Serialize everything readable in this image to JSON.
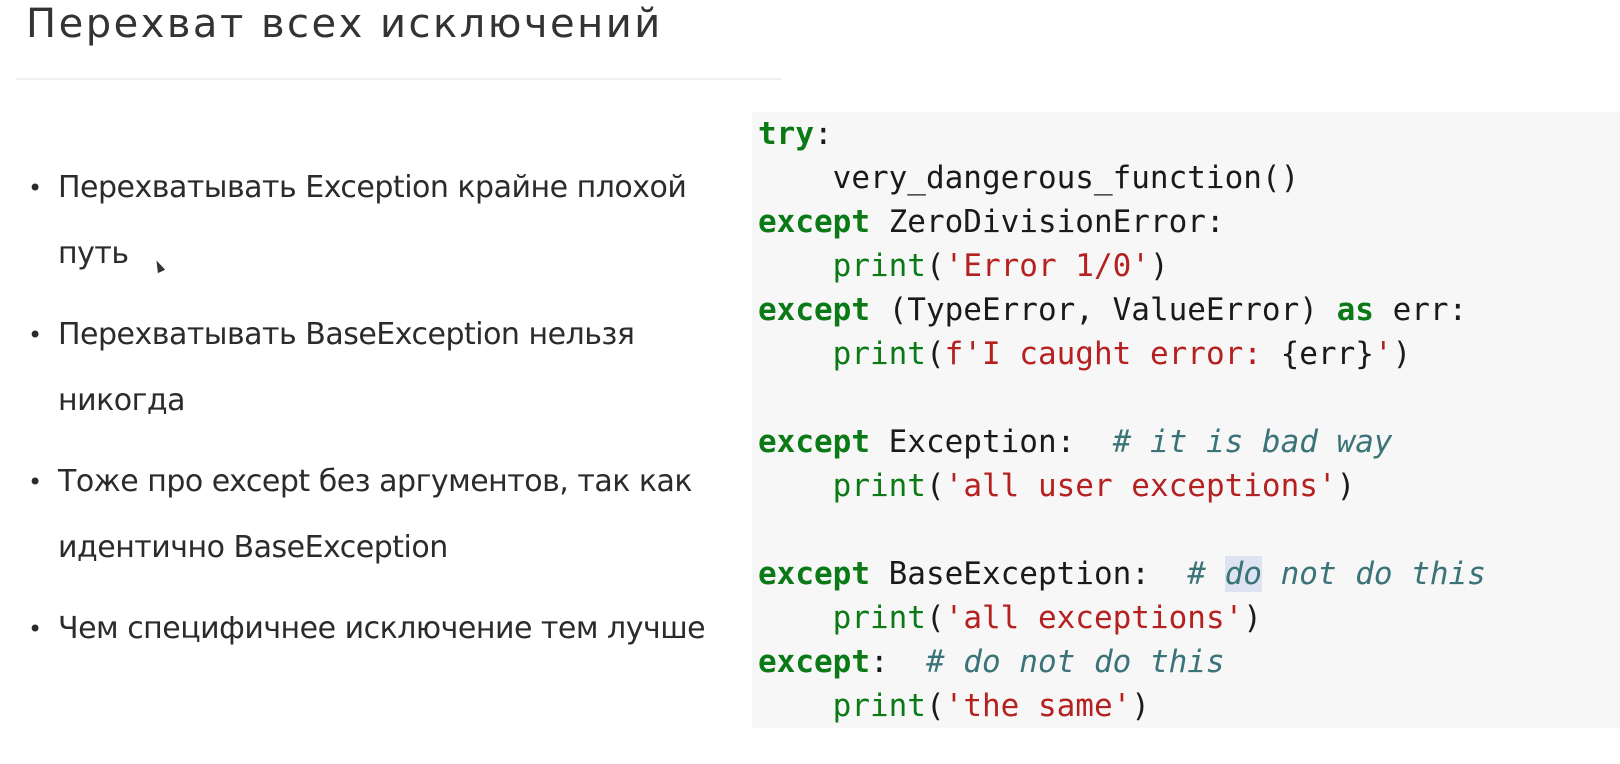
{
  "slide": {
    "title": "Перехват всех исключений",
    "bullets": [
      "Перехватывать Exception крайне плохой путь",
      "Перехватывать BaseException нельзя никогда",
      "Тоже про except без аргументов, так как идентично BaseException",
      "Чем специфичнее исключение тем лучше"
    ]
  },
  "code": {
    "lines": [
      [
        {
          "t": "try",
          "c": "kw"
        },
        {
          "t": ":",
          "c": ""
        }
      ],
      [
        {
          "t": "    very_dangerous_function()",
          "c": ""
        }
      ],
      [
        {
          "t": "except",
          "c": "kw"
        },
        {
          "t": " ZeroDivisionError:",
          "c": ""
        }
      ],
      [
        {
          "t": "    ",
          "c": ""
        },
        {
          "t": "print",
          "c": "bi"
        },
        {
          "t": "(",
          "c": ""
        },
        {
          "t": "'Error 1/0'",
          "c": "str"
        },
        {
          "t": ")",
          "c": ""
        }
      ],
      [
        {
          "t": "except",
          "c": "kw"
        },
        {
          "t": " (TypeError, ValueError) ",
          "c": ""
        },
        {
          "t": "as",
          "c": "kw"
        },
        {
          "t": " err:",
          "c": ""
        }
      ],
      [
        {
          "t": "    ",
          "c": ""
        },
        {
          "t": "print",
          "c": "bi"
        },
        {
          "t": "(",
          "c": ""
        },
        {
          "t": "f'I caught error: ",
          "c": "str"
        },
        {
          "t": "{err}",
          "c": ""
        },
        {
          "t": "'",
          "c": "str"
        },
        {
          "t": ")",
          "c": ""
        }
      ],
      [
        {
          "t": "",
          "c": ""
        }
      ],
      [
        {
          "t": "except",
          "c": "kw"
        },
        {
          "t": " Exception:  ",
          "c": ""
        },
        {
          "t": "# it is bad way",
          "c": "cm"
        }
      ],
      [
        {
          "t": "    ",
          "c": ""
        },
        {
          "t": "print",
          "c": "bi"
        },
        {
          "t": "(",
          "c": ""
        },
        {
          "t": "'all user exceptions'",
          "c": "str"
        },
        {
          "t": ")",
          "c": ""
        }
      ],
      [
        {
          "t": "",
          "c": ""
        }
      ],
      [
        {
          "t": "except",
          "c": "kw"
        },
        {
          "t": " BaseException:  ",
          "c": ""
        },
        {
          "t": "# ",
          "c": "cm"
        },
        {
          "t": "do",
          "c": "cm hl"
        },
        {
          "t": " not do this",
          "c": "cm"
        }
      ],
      [
        {
          "t": "    ",
          "c": ""
        },
        {
          "t": "print",
          "c": "bi"
        },
        {
          "t": "(",
          "c": ""
        },
        {
          "t": "'all exceptions'",
          "c": "str"
        },
        {
          "t": ")",
          "c": ""
        }
      ],
      [
        {
          "t": "except",
          "c": "kw"
        },
        {
          "t": ":  ",
          "c": ""
        },
        {
          "t": "# do not do this",
          "c": "cm"
        }
      ],
      [
        {
          "t": "    ",
          "c": ""
        },
        {
          "t": "print",
          "c": "bi"
        },
        {
          "t": "(",
          "c": ""
        },
        {
          "t": "'the same'",
          "c": "str"
        },
        {
          "t": ")",
          "c": ""
        }
      ]
    ]
  },
  "colors": {
    "keyword": "#0b7a16",
    "string": "#b52120",
    "comment": "#3a7478",
    "code_background": "#f7f7f7"
  }
}
